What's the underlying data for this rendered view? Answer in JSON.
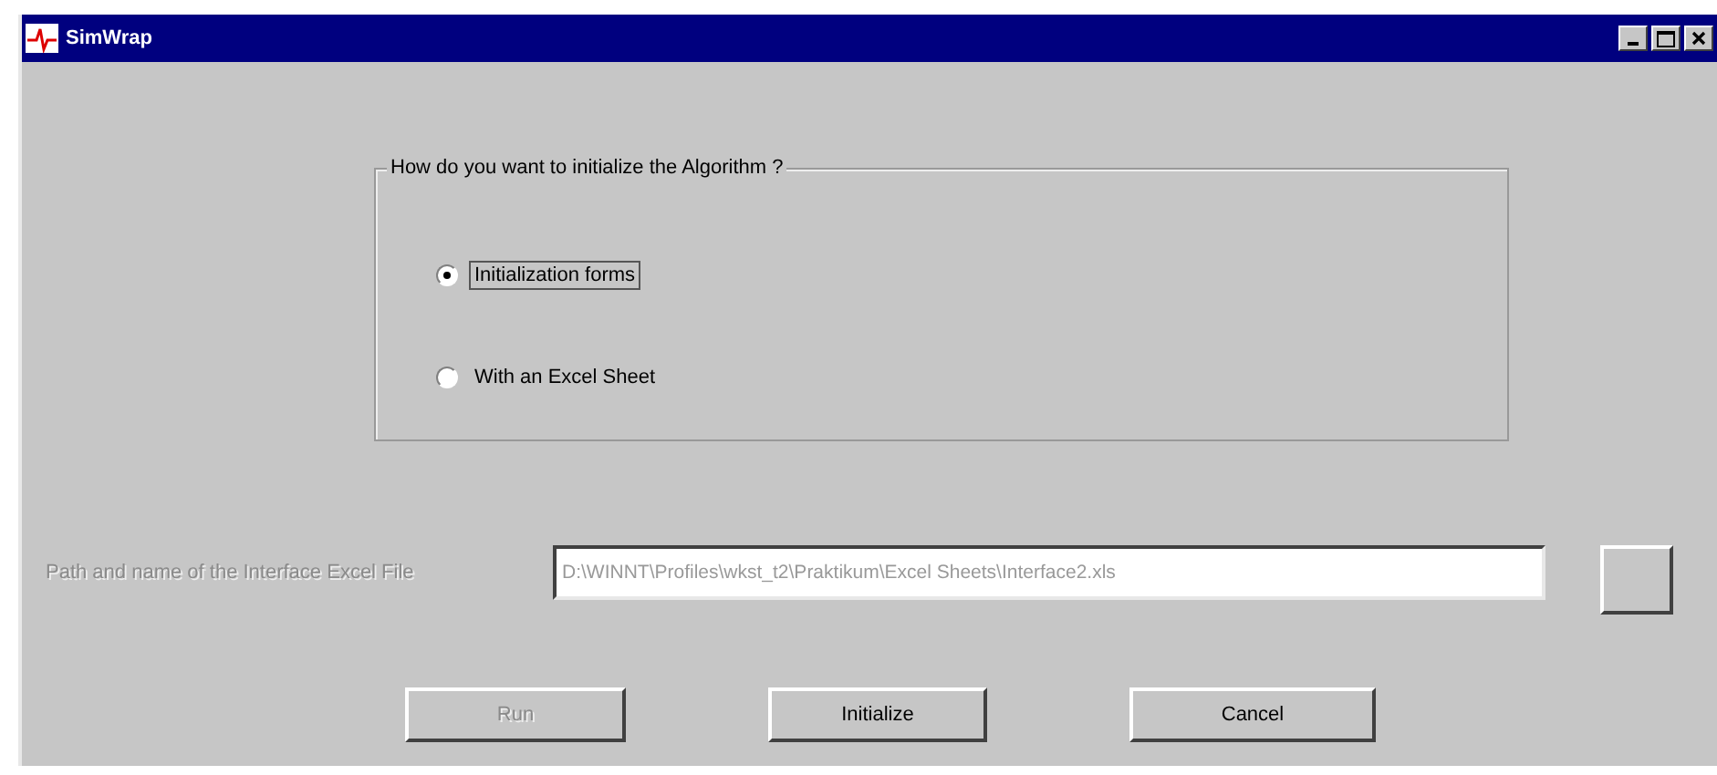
{
  "window": {
    "title": "SimWrap"
  },
  "init_group": {
    "title": "How do you want to initialize the Algorithm ?",
    "options": [
      {
        "label": "Initialization forms",
        "selected": true,
        "focused": true
      },
      {
        "label": "With an Excel Sheet",
        "selected": false,
        "focused": false
      }
    ]
  },
  "path": {
    "label": "Path and name of the Interface Excel File",
    "value": "D:\\WINNT\\Profiles\\wkst_t2\\Praktikum\\Excel Sheets\\Interface2.xls",
    "disabled": true
  },
  "buttons": [
    {
      "label": "Run",
      "disabled": true
    },
    {
      "label": "Initialize",
      "disabled": false
    },
    {
      "label": "Cancel",
      "disabled": false
    }
  ]
}
